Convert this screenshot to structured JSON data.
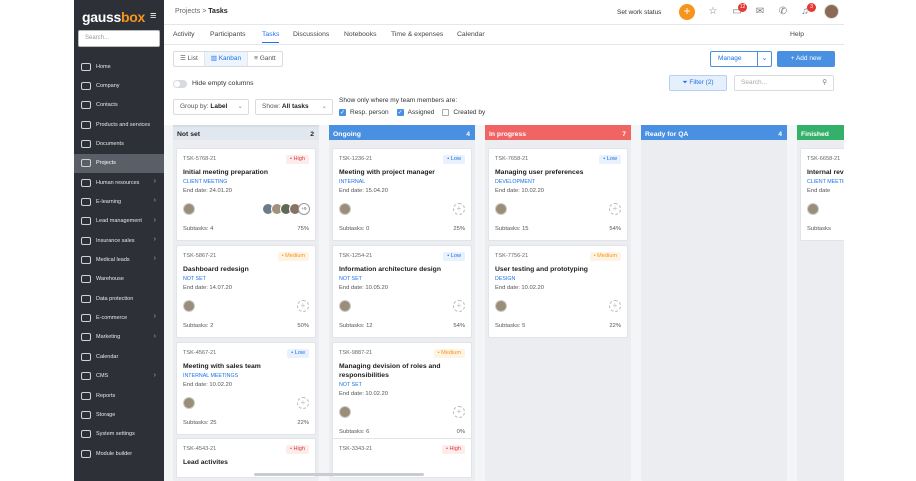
{
  "sidebar": {
    "logo": "gaussbox",
    "search_placeholder": "Search...",
    "items": [
      {
        "label": "Home",
        "chevron": false
      },
      {
        "label": "Company",
        "chevron": false
      },
      {
        "label": "Contacts",
        "chevron": false
      },
      {
        "label": "Products and services",
        "chevron": false
      },
      {
        "label": "Documents",
        "chevron": false
      },
      {
        "label": "Projects",
        "chevron": false,
        "active": true
      },
      {
        "label": "Human resources",
        "chevron": true
      },
      {
        "label": "E-learning",
        "chevron": true
      },
      {
        "label": "Lead management",
        "chevron": true
      },
      {
        "label": "Insurance sales",
        "chevron": true
      },
      {
        "label": "Medical leads",
        "chevron": true
      },
      {
        "label": "Warehouse",
        "chevron": false
      },
      {
        "label": "Data protection",
        "chevron": false
      },
      {
        "label": "E-commerce",
        "chevron": true
      },
      {
        "label": "Marketing",
        "chevron": true
      },
      {
        "label": "Calendar",
        "chevron": false
      },
      {
        "label": "CMS",
        "chevron": true
      },
      {
        "label": "Reports",
        "chevron": false
      },
      {
        "label": "Storage",
        "chevron": false
      },
      {
        "label": "System settings",
        "chevron": false
      },
      {
        "label": "Module builder",
        "chevron": false
      }
    ]
  },
  "header": {
    "breadcrumb_parent": "Projects",
    "breadcrumb_sep": ">",
    "breadcrumb_current": "Tasks",
    "work_status": "Set work status",
    "notif_count": "12",
    "alert_count": "3"
  },
  "tabs": [
    "Activity",
    "Participants",
    "Tasks",
    "Discussions",
    "Notebooks",
    "Time & expenses",
    "Calendar"
  ],
  "help": "Help",
  "views": {
    "list": "List",
    "kanban": "Kanban",
    "gantt": "Gantt"
  },
  "manage": "Manage",
  "add_new": "+ Add new",
  "hide_empty": "Hide empty columns",
  "filter": "Filter (2)",
  "search_placeholder": "Search...",
  "group_by": {
    "prefix": "Group by:",
    "value": "Label"
  },
  "show": {
    "prefix": "Show:",
    "value": "All tasks"
  },
  "show_only": "Show only where my team members are:",
  "checks": [
    {
      "label": "Resp. person",
      "checked": true
    },
    {
      "label": "Assigned",
      "checked": true
    },
    {
      "label": "Created by",
      "checked": false
    }
  ],
  "colors": {
    "accent": "#1a73e8",
    "orange": "#f7941d",
    "high": "#e53935",
    "low": "#1a73e8",
    "medium": "#f7941d"
  },
  "columns": [
    {
      "name": "Not set",
      "count": "2",
      "color": "#d8dce1",
      "bg": "#e1e7ef",
      "text": "#222",
      "cards": [
        {
          "id": "TSK-5768-21",
          "priority": "• High",
          "ptype": "high",
          "title": "Initial meeting preparation",
          "tag": "CLIENT MEETING",
          "end": "End date: 24.01.20",
          "subtasks": "Subtasks: 4",
          "pct": "75%",
          "group": true,
          "more": "+9"
        },
        {
          "id": "TSK-5867-21",
          "priority": "• Medium",
          "ptype": "medium",
          "title": "Dashboard redesign",
          "tag": "NOT SET",
          "end": "End date: 14.07.20",
          "subtasks": "Subtasks: 2",
          "pct": "50%"
        },
        {
          "id": "TSK-4567-21",
          "priority": "• Low",
          "ptype": "low",
          "title": "Meeting with sales team",
          "tag": "INTERNAL MEETINGS",
          "end": "End date: 10.02.20",
          "subtasks": "Subtasks: 25",
          "pct": "22%"
        },
        {
          "id": "TSK-4543-21",
          "priority": "• High",
          "ptype": "high",
          "title": "Lead activites",
          "tag": "",
          "end": "",
          "subtasks": "",
          "pct": ""
        }
      ]
    },
    {
      "name": "Ongoing",
      "count": "4",
      "color": "#4a90e2",
      "bg": "#4a90e2",
      "text": "#fff",
      "cards": [
        {
          "id": "TSK-1236-21",
          "priority": "• Low",
          "ptype": "low",
          "title": "Meeting with project manager",
          "tag": "INTERNAL",
          "end": "End date: 15.04.20",
          "subtasks": "Subtasks: 0",
          "pct": "25%"
        },
        {
          "id": "TSK-1254-21",
          "priority": "• Low",
          "ptype": "low",
          "title": "Information architecture design",
          "tag": "NOT SET",
          "end": "End date: 10.05.20",
          "subtasks": "Subtasks: 12",
          "pct": "54%"
        },
        {
          "id": "TSK-9887-21",
          "priority": "• Medium",
          "ptype": "medium",
          "title": "Managing devision of roles and responsibilities",
          "tag": "NOT SET",
          "end": "End date: 10.02.20",
          "subtasks": "Subtasks: 6",
          "pct": "0%"
        },
        {
          "id": "TSK-3343-21",
          "priority": "• High",
          "ptype": "high",
          "title": "",
          "tag": "",
          "end": "",
          "subtasks": "",
          "pct": ""
        }
      ]
    },
    {
      "name": "In progress",
      "count": "7",
      "color": "#f06464",
      "bg": "#f06464",
      "text": "#fff",
      "cards": [
        {
          "id": "TSK-7658-21",
          "priority": "• Low",
          "ptype": "low",
          "title": "Managing user preferences",
          "tag": "DEVELOPMENT",
          "end": "End date: 10.02.20",
          "subtasks": "Subtasks: 15",
          "pct": "54%"
        },
        {
          "id": "TSK-7756-21",
          "priority": "• Medium",
          "ptype": "medium",
          "title": "User testing and prototyping",
          "tag": "DESIGN",
          "end": "End date: 10.02.20",
          "subtasks": "Subtasks: 5",
          "pct": "22%"
        }
      ]
    },
    {
      "name": "Ready for QA",
      "count": "4",
      "color": "#4a90e2",
      "bg": "#4a90e2",
      "text": "#fff",
      "cards": []
    },
    {
      "name": "Finished",
      "count": "",
      "color": "#34b06b",
      "bg": "#34b06b",
      "text": "#fff",
      "cards": [
        {
          "id": "TSK-6658-21",
          "priority": "",
          "ptype": "low",
          "title": "Internal review",
          "tag": "CLIENT MEETING",
          "end": "End date",
          "subtasks": "Subtasks",
          "pct": ""
        }
      ]
    }
  ]
}
